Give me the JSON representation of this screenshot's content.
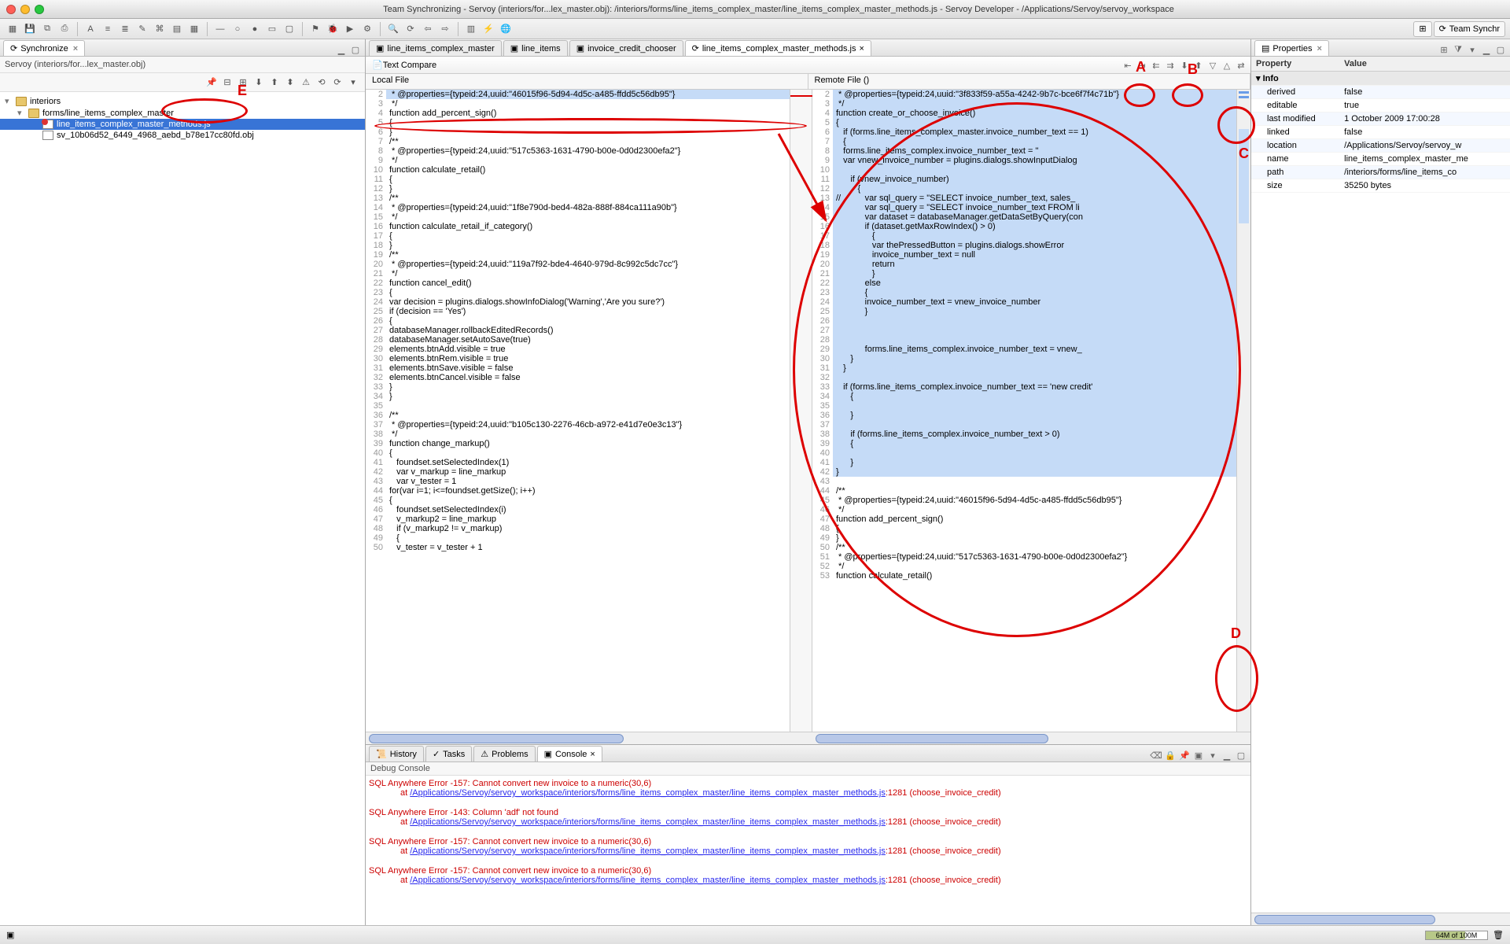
{
  "window": {
    "title": "Team Synchronizing - Servoy (interiors/for...lex_master.obj): /interiors/forms/line_items_complex_master/line_items_complex_master_methods.js - Servoy Developer - /Applications/Servoy/servoy_workspace"
  },
  "perspective": {
    "label": "Team Synchr"
  },
  "sync": {
    "tab_label": "Synchronize",
    "header": "Servoy (interiors/for...lex_master.obj)",
    "tree": {
      "root": "interiors",
      "folder": "forms/line_items_complex_master",
      "file1": "line_items_complex_master_methods.js",
      "file2": "sv_10b06d52_6449_4968_aebd_b78e17cc80fd.obj"
    }
  },
  "editor_tabs": [
    "line_items_complex_master",
    "line_items",
    "invoice_credit_chooser",
    "line_items_complex_master_methods.js"
  ],
  "compare": {
    "title": "Text Compare",
    "left_title": "Local File",
    "right_title": "Remote File ()",
    "left_lines": [
      " * @properties={typeid:24,uuid:\"46015f96-5d94-4d5c-a485-ffdd5c56db95\"}",
      " */",
      "function add_percent_sign()",
      "{",
      "}",
      "/**",
      " * @properties={typeid:24,uuid:\"517c5363-1631-4790-b00e-0d0d2300efa2\"}",
      " */",
      "function calculate_retail()",
      "{",
      "}",
      "/**",
      " * @properties={typeid:24,uuid:\"1f8e790d-bed4-482a-888f-884ca111a90b\"}",
      " */",
      "function calculate_retail_if_category()",
      "{",
      "}",
      "/**",
      " * @properties={typeid:24,uuid:\"119a7f92-bde4-4640-979d-8c992c5dc7cc\"}",
      " */",
      "function cancel_edit()",
      "{",
      "var decision = plugins.dialogs.showInfoDialog('Warning','Are you sure?')",
      "if (decision == 'Yes')",
      "{",
      "databaseManager.rollbackEditedRecords()",
      "databaseManager.setAutoSave(true)",
      "elements.btnAdd.visible = true",
      "elements.btnRem.visible = true",
      "elements.btnSave.visible = false",
      "elements.btnCancel.visible = false",
      "}",
      "}",
      "",
      "/**",
      " * @properties={typeid:24,uuid:\"b105c130-2276-46cb-a972-e41d7e0e3c13\"}",
      " */",
      "function change_markup()",
      "{",
      "   foundset.setSelectedIndex(1)",
      "   var v_markup = line_markup",
      "   var v_tester = 1",
      "for(var i=1; i<=foundset.getSize(); i++)",
      "{",
      "   foundset.setSelectedIndex(i)",
      "   v_markup2 = line_markup",
      "   if (v_markup2 != v_markup)",
      "   {",
      "   v_tester = v_tester + 1"
    ],
    "left_start": 2,
    "right_lines": [
      " * @properties={typeid:24,uuid:\"3f833f59-a55a-4242-9b7c-bce6f7f4c71b\"}",
      " */",
      "function create_or_choose_invoice()",
      "{",
      "   if (forms.line_items_complex_master.invoice_number_text == 1)",
      "   {",
      "   forms.line_items_complex.invoice_number_text = ''",
      "   var vnew_invoice_number = plugins.dialogs.showInputDialog",
      "",
      "      if (vnew_invoice_number)",
      "         {",
      "//          var sql_query = \"SELECT invoice_number_text, sales_",
      "            var sql_query = \"SELECT invoice_number_text FROM li",
      "            var dataset = databaseManager.getDataSetByQuery(con",
      "            if (dataset.getMaxRowIndex() > 0)",
      "               {",
      "               var thePressedButton = plugins.dialogs.showError",
      "               invoice_number_text = null",
      "               return",
      "               }",
      "            else",
      "            {",
      "            invoice_number_text = vnew_invoice_number",
      "            }",
      "",
      "",
      "",
      "            forms.line_items_complex.invoice_number_text = vnew_",
      "      }",
      "   }",
      "",
      "   if (forms.line_items_complex.invoice_number_text == 'new credit'",
      "      {",
      "",
      "      }",
      "",
      "      if (forms.line_items_complex.invoice_number_text > 0)",
      "      {",
      "",
      "      }",
      "}",
      "",
      "/**",
      " * @properties={typeid:24,uuid:\"46015f96-5d94-4d5c-a485-ffdd5c56db95\"}",
      " */",
      "function add_percent_sign()",
      "{",
      "}",
      "/**",
      " * @properties={typeid:24,uuid:\"517c5363-1631-4790-b00e-0d0d2300efa2\"}",
      " */",
      "function calculate_retail()"
    ],
    "right_start": 2
  },
  "bottom_tabs": [
    "History",
    "Tasks",
    "Problems",
    "Console"
  ],
  "console": {
    "header": "Debug Console",
    "entries": [
      {
        "msg": "SQL Anywhere Error -157: Cannot convert new invoice to a numeric(30,6)",
        "at": "at",
        "link": "/Applications/Servoy/servoy_workspace/interiors/forms/line_items_complex_master/line_items_complex_master_methods.js",
        "loc": ":1281 (choose_invoice_credit)"
      },
      {
        "msg": "SQL Anywhere Error -143: Column 'adf' not found",
        "at": "at",
        "link": "/Applications/Servoy/servoy_workspace/interiors/forms/line_items_complex_master/line_items_complex_master_methods.js",
        "loc": ":1281 (choose_invoice_credit)"
      },
      {
        "msg": "SQL Anywhere Error -157: Cannot convert new invoice to a numeric(30,6)",
        "at": "at",
        "link": "/Applications/Servoy/servoy_workspace/interiors/forms/line_items_complex_master/line_items_complex_master_methods.js",
        "loc": ":1281 (choose_invoice_credit)"
      },
      {
        "msg": "SQL Anywhere Error -157: Cannot convert new invoice to a numeric(30,6)",
        "at": "at",
        "link": "/Applications/Servoy/servoy_workspace/interiors/forms/line_items_complex_master/line_items_complex_master_methods.js",
        "loc": ":1281 (choose_invoice_credit)"
      }
    ]
  },
  "properties": {
    "tab_label": "Properties",
    "header_prop": "Property",
    "header_val": "Value",
    "cat": "Info",
    "rows": [
      {
        "k": "derived",
        "v": "false"
      },
      {
        "k": "editable",
        "v": "true"
      },
      {
        "k": "last modified",
        "v": "1 October 2009 17:00:28"
      },
      {
        "k": "linked",
        "v": "false"
      },
      {
        "k": "location",
        "v": "/Applications/Servoy/servoy_w"
      },
      {
        "k": "name",
        "v": "line_items_complex_master_me"
      },
      {
        "k": "path",
        "v": "/interiors/forms/line_items_co"
      },
      {
        "k": "size",
        "v": "35250 bytes"
      }
    ]
  },
  "status": {
    "mem": "64M of 100M"
  },
  "annotations": {
    "A": "A",
    "B": "B",
    "C": "C",
    "D": "D",
    "E": "E"
  }
}
